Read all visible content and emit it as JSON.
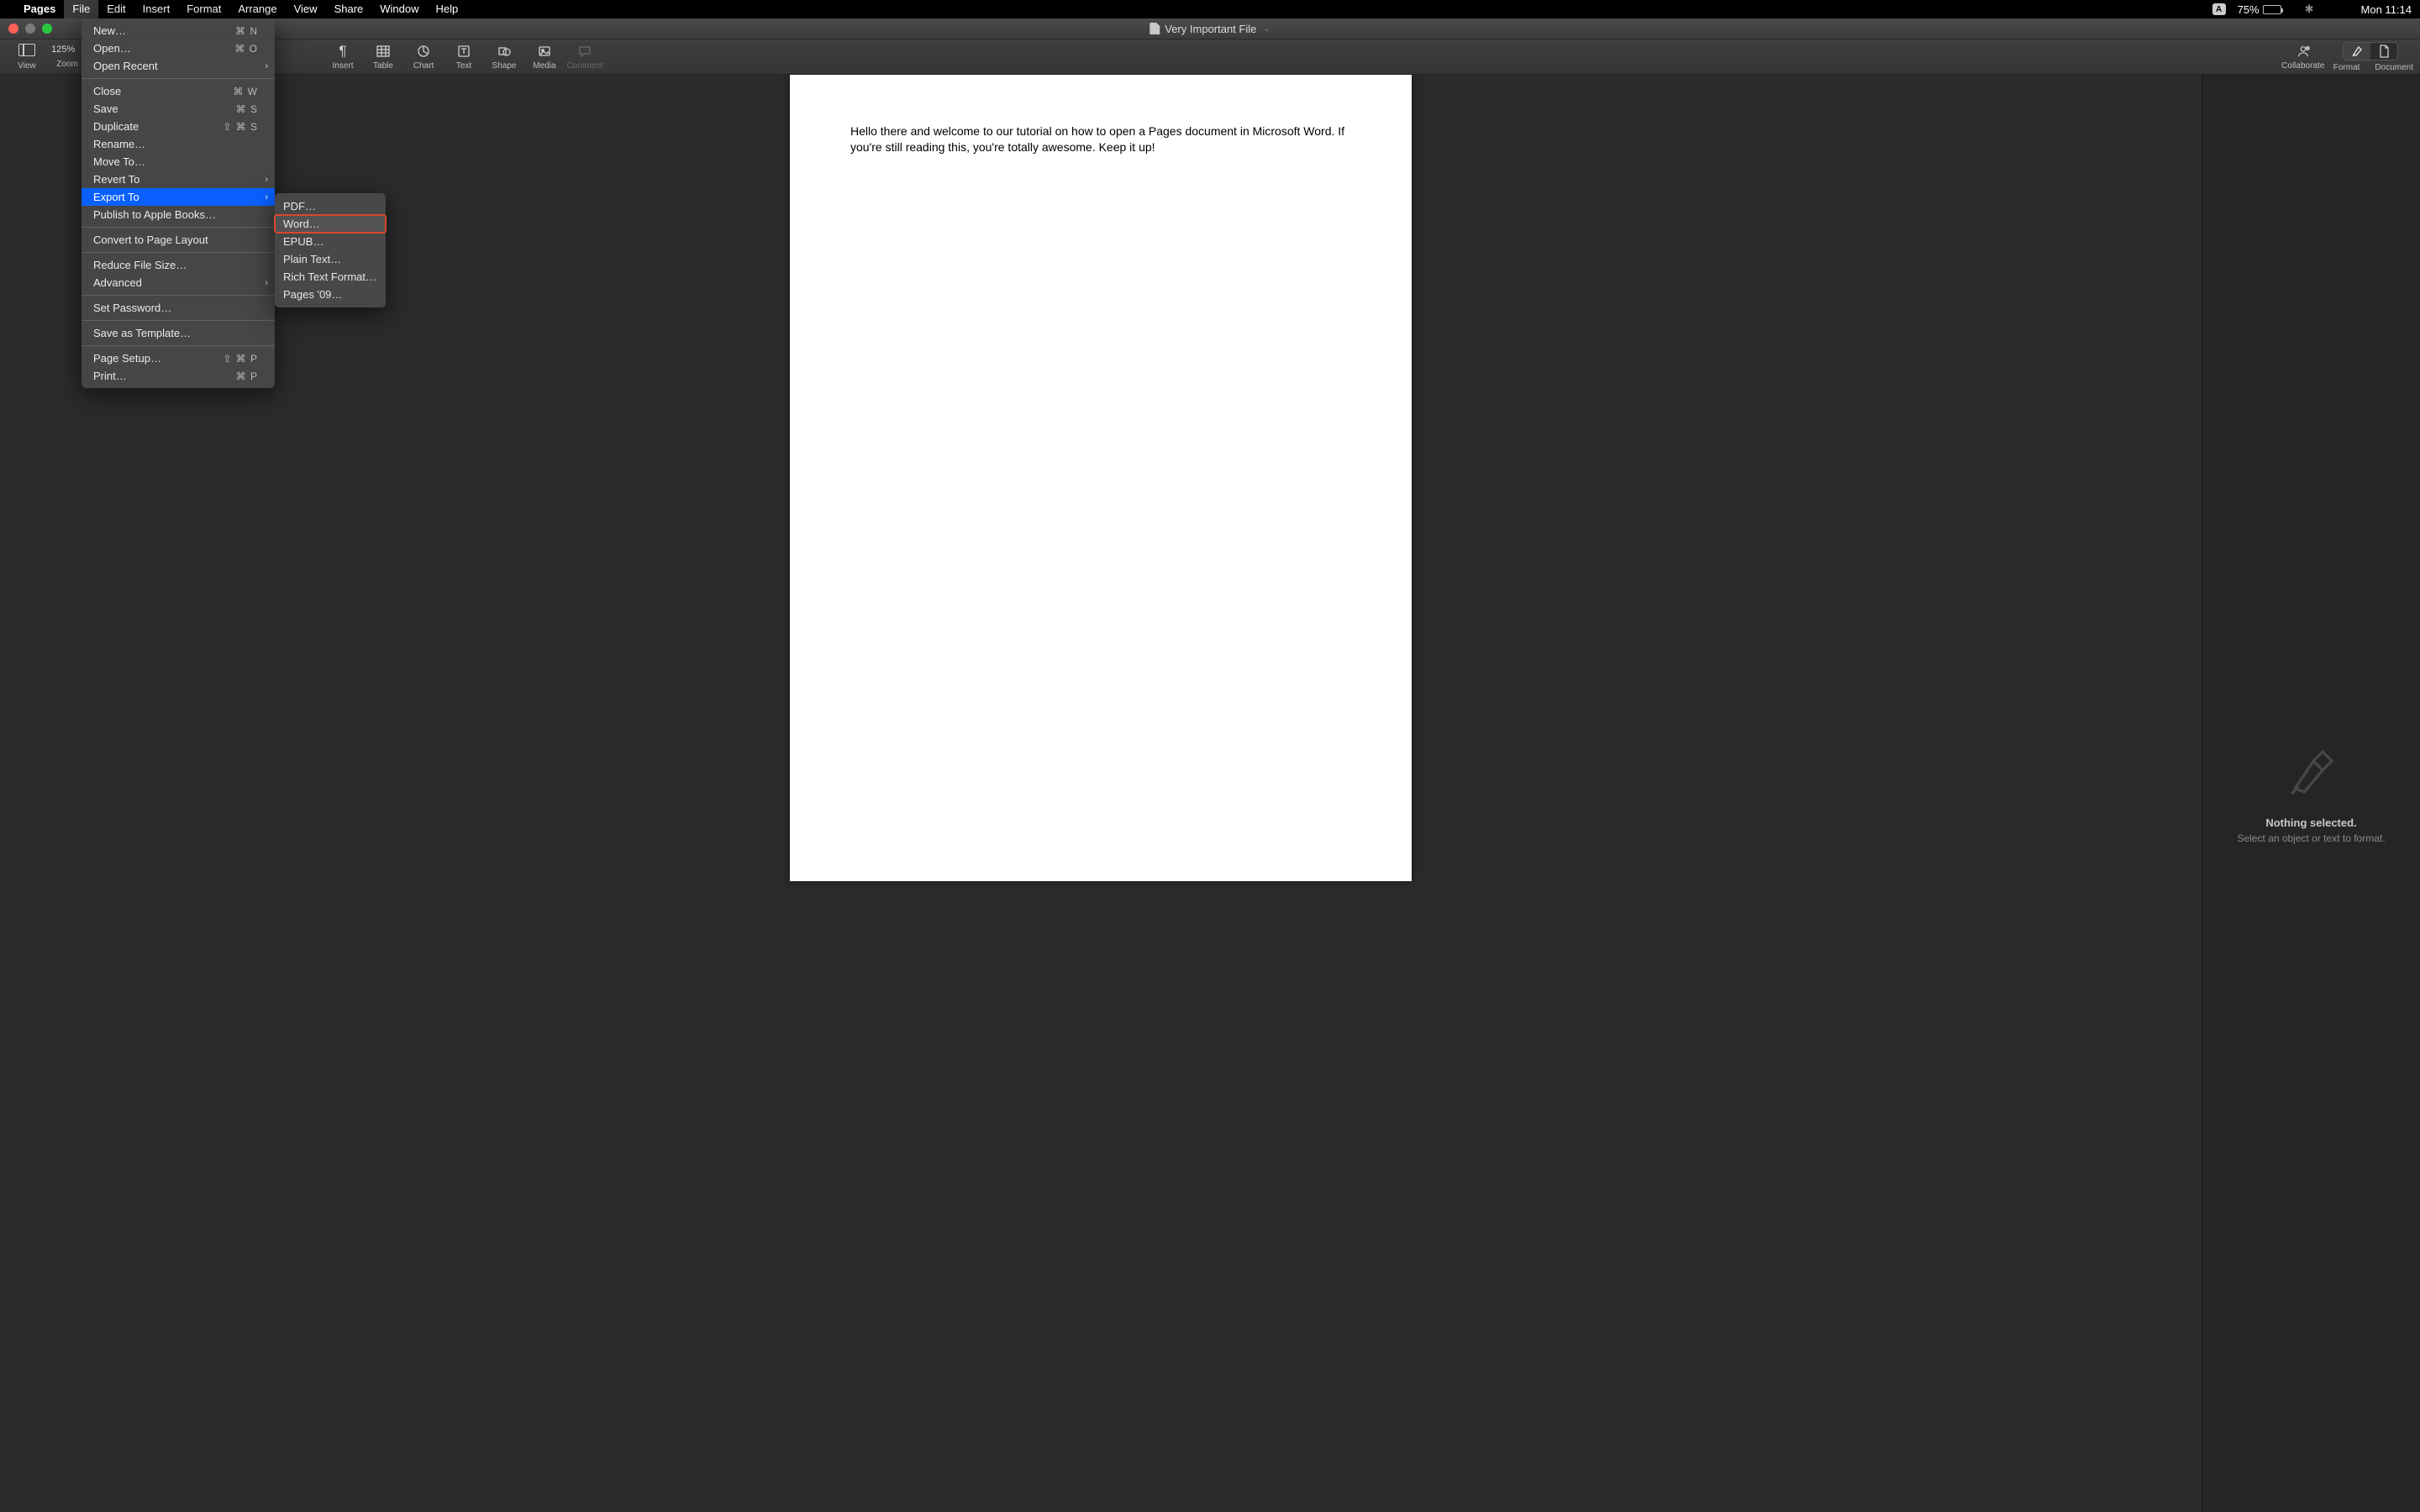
{
  "menubar": {
    "app_name": "Pages",
    "items": [
      "File",
      "Edit",
      "Insert",
      "Format",
      "Arrange",
      "View",
      "Share",
      "Window",
      "Help"
    ],
    "active_index": 0,
    "status": {
      "input_badge": "A",
      "battery_pct": "75%",
      "clock": "Mon 11:14"
    }
  },
  "window": {
    "title": "Very Important File",
    "toolbar_left": [
      {
        "label": "View"
      },
      {
        "label": "Zoom",
        "value": "125%"
      }
    ],
    "toolbar_center": [
      {
        "label": "Insert"
      },
      {
        "label": "Table"
      },
      {
        "label": "Chart"
      },
      {
        "label": "Text"
      },
      {
        "label": "Shape"
      },
      {
        "label": "Media"
      },
      {
        "label": "Comment",
        "disabled": true
      }
    ],
    "toolbar_right": [
      {
        "label": "Collaborate"
      },
      {
        "label": "Format"
      },
      {
        "label": "Document"
      }
    ]
  },
  "document": {
    "body": "Hello there and welcome to our tutorial on how to open a Pages document in Microsoft Word. If you're still reading this, you're totally awesome. Keep it up!"
  },
  "inspector": {
    "title": "Nothing selected.",
    "subtitle": "Select an object or text to format."
  },
  "file_menu": {
    "highlighted": "Export To",
    "groups": [
      [
        {
          "label": "New…",
          "shortcut": "⌘ N"
        },
        {
          "label": "Open…",
          "shortcut": "⌘ O"
        },
        {
          "label": "Open Recent",
          "submenu": true
        }
      ],
      [
        {
          "label": "Close",
          "shortcut": "⌘ W"
        },
        {
          "label": "Save",
          "shortcut": "⌘ S"
        },
        {
          "label": "Duplicate",
          "shortcut": "⇧ ⌘ S"
        },
        {
          "label": "Rename…"
        },
        {
          "label": "Move To…"
        },
        {
          "label": "Revert To",
          "submenu": true
        },
        {
          "label": "Export To",
          "submenu": true,
          "highlight": true
        },
        {
          "label": "Publish to Apple Books…"
        }
      ],
      [
        {
          "label": "Convert to Page Layout"
        }
      ],
      [
        {
          "label": "Reduce File Size…"
        },
        {
          "label": "Advanced",
          "submenu": true
        }
      ],
      [
        {
          "label": "Set Password…"
        }
      ],
      [
        {
          "label": "Save as Template…"
        }
      ],
      [
        {
          "label": "Page Setup…",
          "shortcut": "⇧ ⌘ P"
        },
        {
          "label": "Print…",
          "shortcut": "⌘ P"
        }
      ]
    ]
  },
  "export_submenu": {
    "boxed": "Word…",
    "items": [
      "PDF…",
      "Word…",
      "EPUB…",
      "Plain Text…",
      "Rich Text Format…",
      "Pages '09…"
    ]
  }
}
